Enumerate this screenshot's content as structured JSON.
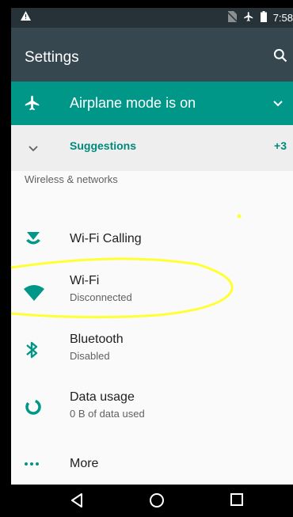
{
  "status_bar": {
    "time": "7:58"
  },
  "app_bar": {
    "title": "Settings",
    "search_icon": "search-icon"
  },
  "airplane_banner": {
    "text": "Airplane mode is on",
    "icon": "airplane-icon"
  },
  "suggestions": {
    "label": "Suggestions",
    "count": "+3"
  },
  "section": {
    "header": "Wireless & networks"
  },
  "items": [
    {
      "title": "Wi-Fi Calling",
      "subtitle": "",
      "icon": "wifi-calling-icon"
    },
    {
      "title": "Wi-Fi",
      "subtitle": "Disconnected",
      "icon": "wifi-icon"
    },
    {
      "title": "Bluetooth",
      "subtitle": "Disabled",
      "icon": "bluetooth-icon"
    },
    {
      "title": "Data usage",
      "subtitle": "0 B of data used",
      "icon": "data-usage-icon"
    },
    {
      "title": "More",
      "subtitle": "",
      "icon": "more-icon"
    }
  ],
  "colors": {
    "status_bar": "#263238",
    "app_bar": "#37474f",
    "accent": "#009688",
    "annotation": "#ffff33"
  }
}
